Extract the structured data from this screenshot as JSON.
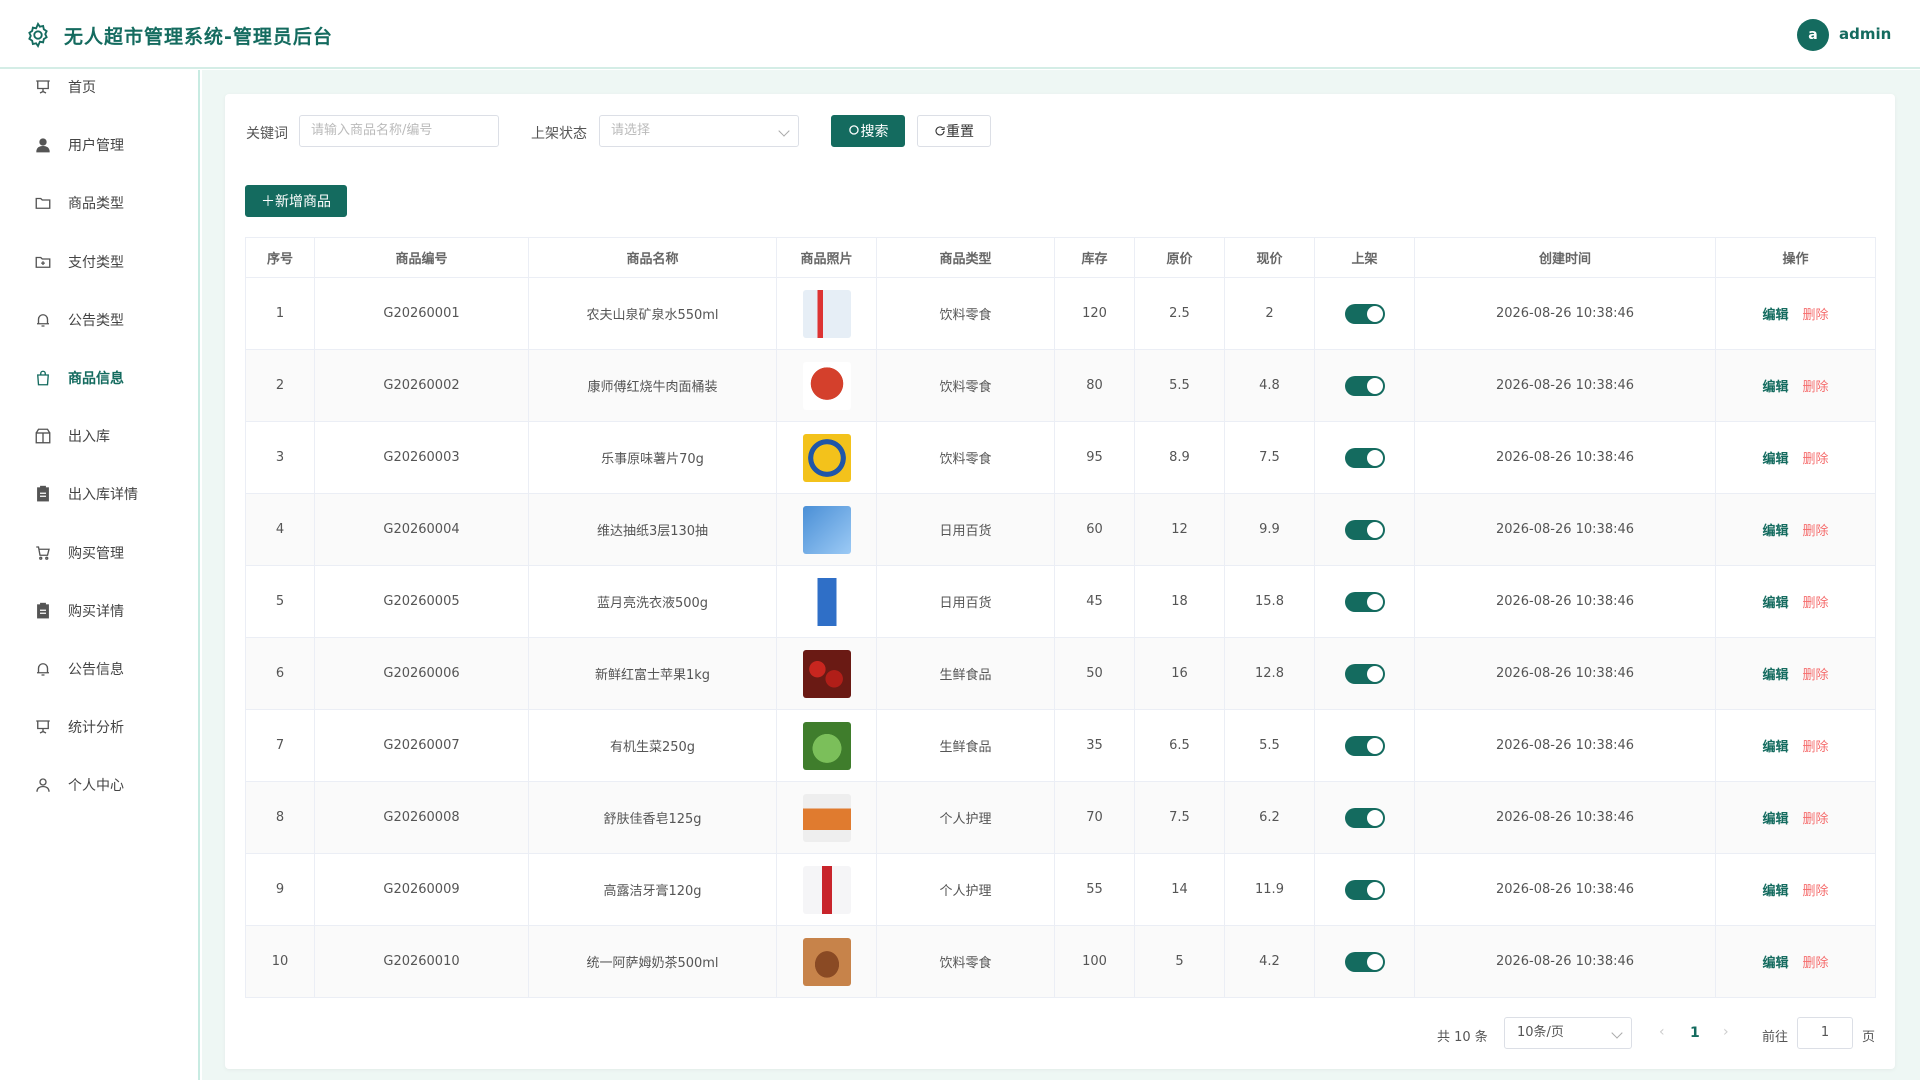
{
  "app": {
    "title": "无人超市管理系统-管理员后台"
  },
  "user": {
    "avatar_letter": "a",
    "name": "admin"
  },
  "sidebar": {
    "items": [
      {
        "label": "首页",
        "icon": "presentation-icon"
      },
      {
        "label": "用户管理",
        "icon": "user-icon"
      },
      {
        "label": "商品类型",
        "icon": "folder-icon"
      },
      {
        "label": "支付类型",
        "icon": "folder-add-icon"
      },
      {
        "label": "公告类型",
        "icon": "bell-icon"
      },
      {
        "label": "商品信息",
        "icon": "shopping-bag-icon",
        "active": true
      },
      {
        "label": "出入库",
        "icon": "box-icon"
      },
      {
        "label": "出入库详情",
        "icon": "clipboard-icon"
      },
      {
        "label": "购买管理",
        "icon": "cart-icon"
      },
      {
        "label": "购买详情",
        "icon": "clipboard-icon"
      },
      {
        "label": "公告信息",
        "icon": "bell-icon"
      },
      {
        "label": "统计分析",
        "icon": "presentation-icon"
      },
      {
        "label": "个人中心",
        "icon": "user-outline-icon"
      }
    ]
  },
  "filters": {
    "keyword_label": "关键词",
    "keyword_placeholder": "请输入商品名称/编号",
    "status_label": "上架状态",
    "status_placeholder": "请选择",
    "search_label": "搜索",
    "reset_label": "重置"
  },
  "toolbar": {
    "add_label": "新增商品"
  },
  "table": {
    "columns": [
      "序号",
      "商品编号",
      "商品名称",
      "商品照片",
      "商品类型",
      "库存",
      "原价",
      "现价",
      "上架",
      "创建时间",
      "操作"
    ],
    "rows": [
      {
        "no": "1",
        "code": "G20260001",
        "name": "农夫山泉矿泉水550ml",
        "photo": "water-bottle",
        "type": "饮料零食",
        "stock": "120",
        "orig": "2.5",
        "price": "2",
        "on": true,
        "created": "2026-08-26 10:38:46"
      },
      {
        "no": "2",
        "code": "G20260002",
        "name": "康师傅红烧牛肉面桶装",
        "photo": "noodle-cup",
        "type": "饮料零食",
        "stock": "80",
        "orig": "5.5",
        "price": "4.8",
        "on": true,
        "created": "2026-08-26 10:38:46"
      },
      {
        "no": "3",
        "code": "G20260003",
        "name": "乐事原味薯片70g",
        "photo": "chips-bag",
        "type": "饮料零食",
        "stock": "95",
        "orig": "8.9",
        "price": "7.5",
        "on": true,
        "created": "2026-08-26 10:38:46"
      },
      {
        "no": "4",
        "code": "G20260004",
        "name": "维达抽纸3层130抽",
        "photo": "tissue-box",
        "type": "日用百货",
        "stock": "60",
        "orig": "12",
        "price": "9.9",
        "on": true,
        "created": "2026-08-26 10:38:46"
      },
      {
        "no": "5",
        "code": "G20260005",
        "name": "蓝月亮洗衣液500g",
        "photo": "detergent-bottle",
        "type": "日用百货",
        "stock": "45",
        "orig": "18",
        "price": "15.8",
        "on": true,
        "created": "2026-08-26 10:38:46"
      },
      {
        "no": "6",
        "code": "G20260006",
        "name": "新鲜红富士苹果1kg",
        "photo": "apples",
        "type": "生鲜食品",
        "stock": "50",
        "orig": "16",
        "price": "12.8",
        "on": true,
        "created": "2026-08-26 10:38:46"
      },
      {
        "no": "7",
        "code": "G20260007",
        "name": "有机生菜250g",
        "photo": "lettuce",
        "type": "生鲜食品",
        "stock": "35",
        "orig": "6.5",
        "price": "5.5",
        "on": true,
        "created": "2026-08-26 10:38:46"
      },
      {
        "no": "8",
        "code": "G20260008",
        "name": "舒肤佳香皂125g",
        "photo": "soap-bar",
        "type": "个人护理",
        "stock": "70",
        "orig": "7.5",
        "price": "6.2",
        "on": true,
        "created": "2026-08-26 10:38:46"
      },
      {
        "no": "9",
        "code": "G20260009",
        "name": "高露洁牙膏120g",
        "photo": "toothpaste",
        "type": "个人护理",
        "stock": "55",
        "orig": "14",
        "price": "11.9",
        "on": true,
        "created": "2026-08-26 10:38:46"
      },
      {
        "no": "10",
        "code": "G20260010",
        "name": "统一阿萨姆奶茶500ml",
        "photo": "milk-tea-bottle",
        "type": "饮料零食",
        "stock": "100",
        "orig": "5",
        "price": "4.2",
        "on": true,
        "created": "2026-08-26 10:38:46"
      }
    ],
    "edit_label": "编辑",
    "delete_label": "删除"
  },
  "pagination": {
    "total_text": "共 10 条",
    "page_size": "10条/页",
    "current_page": "1",
    "goto_label": "前往",
    "goto_value": "1",
    "page_suffix": "页"
  },
  "colors": {
    "primary": "#146b5f",
    "danger": "#f56c6c",
    "bg": "#eef7f4"
  }
}
